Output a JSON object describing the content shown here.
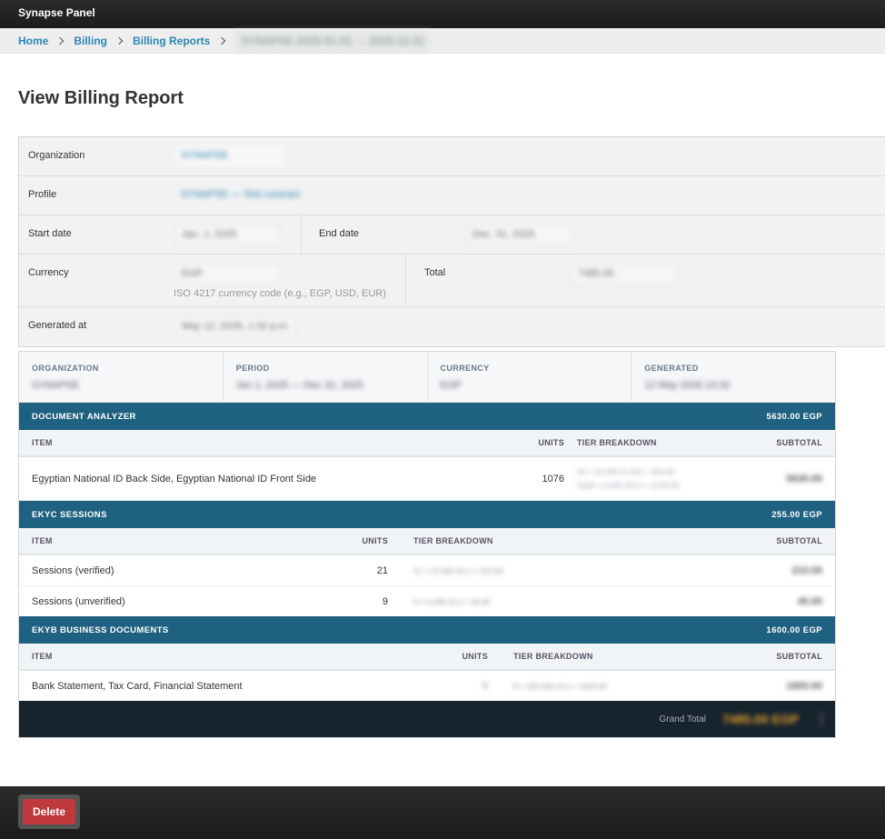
{
  "app": {
    "title": "Synapse Panel"
  },
  "breadcrumb": {
    "items": [
      "Home",
      "Billing",
      "Billing Reports"
    ],
    "current": "SYNAPSE 2025-01-01 → 2025-12-31"
  },
  "page": {
    "title": "View Billing Report"
  },
  "form": {
    "organization": {
      "label": "Organization",
      "value": "SYNAPSE"
    },
    "profile": {
      "label": "Profile",
      "value": "SYNAPSE — Test contract"
    },
    "start_date": {
      "label": "Start date",
      "value": "Jan. 1, 2025"
    },
    "end_date": {
      "label": "End date",
      "value": "Dec. 31, 2025"
    },
    "currency": {
      "label": "Currency",
      "value": "EGP",
      "help": "ISO 4217 currency code (e.g., EGP, USD, EUR)"
    },
    "total": {
      "label": "Total",
      "value": "7485.00"
    },
    "generated_at": {
      "label": "Generated at",
      "value": "May 12, 2026, 1:32 p.m."
    }
  },
  "report": {
    "meta": [
      {
        "label": "ORGANIZATION",
        "value": "SYNAPSE"
      },
      {
        "label": "PERIOD",
        "value": "Jan 1, 2025 — Dec 31, 2025"
      },
      {
        "label": "CURRENCY",
        "value": "EGP"
      },
      {
        "label": "GENERATED",
        "value": "12 May 2026 13:32"
      }
    ],
    "columns": {
      "item": "ITEM",
      "units": "UNITS",
      "tier": "TIER BREAKDOWN",
      "subtotal": "SUBTOTAL"
    },
    "sections": [
      {
        "title": "DOCUMENT ANALYZER",
        "total": "5630.00 EGP",
        "rows": [
          {
            "item": "Egyptian National ID Back Side, Egyptian National ID Front Side",
            "units": "1076",
            "tier_line1": "50 × 10.000 (0–50) = 500.00",
            "tier_line2": "1026 × 5.000 (50+) = 5130.00",
            "subtotal": "5630.00"
          }
        ]
      },
      {
        "title": "EKYC SESSIONS",
        "total": "255.00 EGP",
        "rows": [
          {
            "item": "Sessions (verified)",
            "units": "21",
            "tier": "21 × 10.000 (0+) = 210.00",
            "subtotal": "210.00"
          },
          {
            "item": "Sessions (unverified)",
            "units": "9",
            "tier": "9 × 5.000 (0+) = 45.00",
            "subtotal": "45.00"
          }
        ]
      },
      {
        "title": "EKYB BUSINESS DOCUMENTS",
        "total": "1600.00 EGP",
        "rows": [
          {
            "item": "Bank Statement, Tax Card, Financial Statement",
            "units": "8",
            "tier": "8 × 200.000 (0+) = 1600.00",
            "subtotal": "1600.00"
          }
        ]
      }
    ],
    "grand_total": {
      "label": "Grand Total",
      "value": "7485.00 EGP"
    }
  },
  "actions": {
    "delete_label": "Delete"
  },
  "colors": {
    "section_header": "#1e6180",
    "grand_total_bar": "#17232d",
    "delete_button": "#c0393d",
    "link": "#2a86b5"
  }
}
